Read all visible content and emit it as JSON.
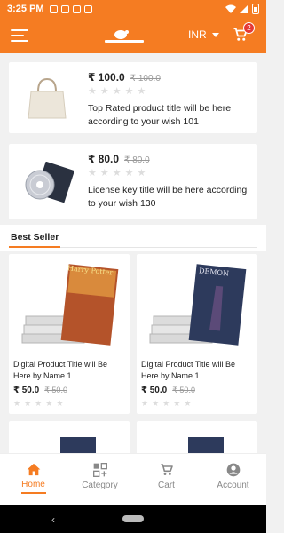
{
  "status": {
    "time": "3:25 PM"
  },
  "header": {
    "currency": "INR",
    "cart_count": "2"
  },
  "products": [
    {
      "price": "₹ 100.0",
      "old_price": "₹ 100.0",
      "title": "Top Rated product title will be here according to your wish 101"
    },
    {
      "price": "₹ 80.0",
      "old_price": "₹ 80.0",
      "title": "License key title will be here according to your wish 130"
    }
  ],
  "best_seller": {
    "label": "Best Seller",
    "items": [
      {
        "title": "Digital Product Title will Be Here by Name 1",
        "price": "₹ 50.0",
        "old_price": "₹ 50.0",
        "cover_text": "Harry Potter"
      },
      {
        "title": "Digital Product Title will Be Here by Name 1",
        "price": "₹ 50.0",
        "old_price": "₹ 50.0",
        "cover_text": "DEMON"
      }
    ]
  },
  "nav": {
    "home": "Home",
    "category": "Category",
    "cart": "Cart",
    "account": "Account"
  },
  "colors": {
    "brand": "#f57c22",
    "badge": "#e53935"
  }
}
